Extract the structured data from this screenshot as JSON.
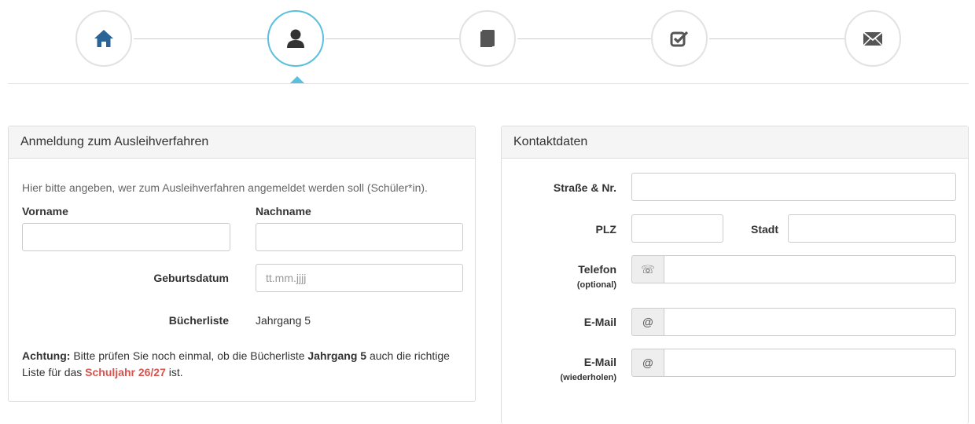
{
  "wizard": {
    "steps": [
      {
        "icon": "home-icon",
        "active": false
      },
      {
        "icon": "user-icon",
        "active": true
      },
      {
        "icon": "book-icon",
        "active": false
      },
      {
        "icon": "check-icon",
        "active": false
      },
      {
        "icon": "envelope-icon",
        "active": false
      }
    ],
    "accent": "#5bc0de",
    "icon_color_active": "#333333",
    "icon_color_default": "#555555",
    "home_icon_color": "#2a6496"
  },
  "left_panel": {
    "title": "Anmeldung zum Ausleihverfahren",
    "hint": "Hier bitte angeben, wer zum Ausleihverfahren angemeldet werden soll (Schüler*in).",
    "vorname_label": "Vorname",
    "vorname_value": "",
    "nachname_label": "Nachname",
    "nachname_value": "",
    "geburtsdatum_label": "Geburtsdatum",
    "geburtsdatum_placeholder": "tt.mm.jjjj",
    "buecherliste_label": "Bücherliste",
    "buecherliste_value": "Jahrgang 5",
    "note": {
      "prefix_bold": "Achtung:",
      "text1": " Bitte prüfen Sie noch einmal, ob die Bücherliste ",
      "bold_list": "Jahrgang 5",
      "text2": " auch die richtige Liste für das ",
      "red_year": "Schuljahr 26/27",
      "text3": " ist."
    }
  },
  "right_panel": {
    "title": "Kontaktdaten",
    "strasse_label": "Straße & Nr.",
    "strasse_value": "",
    "plz_label": "PLZ",
    "plz_value": "",
    "stadt_label": "Stadt",
    "stadt_value": "",
    "telefon_label": "Telefon",
    "telefon_sub": "(optional)",
    "telefon_addon": "☏",
    "telefon_value": "",
    "email_label": "E-Mail",
    "email_addon": "@",
    "email_value": "",
    "email2_label": "E-Mail",
    "email2_sub": "(wiederholen)",
    "email2_addon": "@",
    "email2_value": ""
  },
  "colors": {
    "warning_red": "#d9534f",
    "panel_heading_bg": "#f5f5f5",
    "border": "#dddddd"
  }
}
